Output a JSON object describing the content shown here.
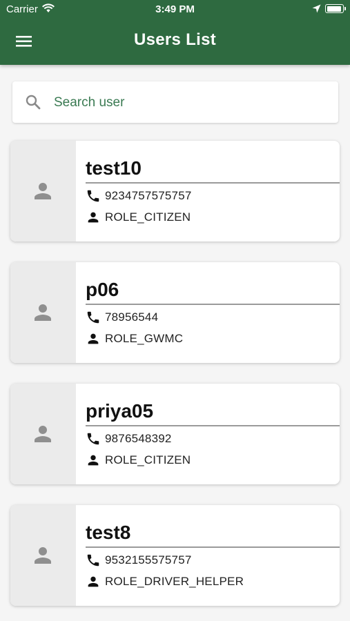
{
  "status_bar": {
    "carrier": "Carrier",
    "time": "3:49 PM"
  },
  "header": {
    "title": "Users List",
    "background_color": "#2e6a40"
  },
  "search": {
    "placeholder": "Search user"
  },
  "users": [
    {
      "name": "test10",
      "phone": "9234757575757",
      "role": "ROLE_CITIZEN"
    },
    {
      "name": "p06",
      "phone": "78956544",
      "role": "ROLE_GWMC"
    },
    {
      "name": "priya05",
      "phone": "9876548392",
      "role": "ROLE_CITIZEN"
    },
    {
      "name": "test8",
      "phone": "9532155575757",
      "role": "ROLE_DRIVER_HELPER"
    }
  ],
  "icons": {
    "menu": "hamburger-menu-icon",
    "search": "search-icon",
    "avatar": "person-icon",
    "phone": "phone-icon",
    "role": "person-icon"
  }
}
